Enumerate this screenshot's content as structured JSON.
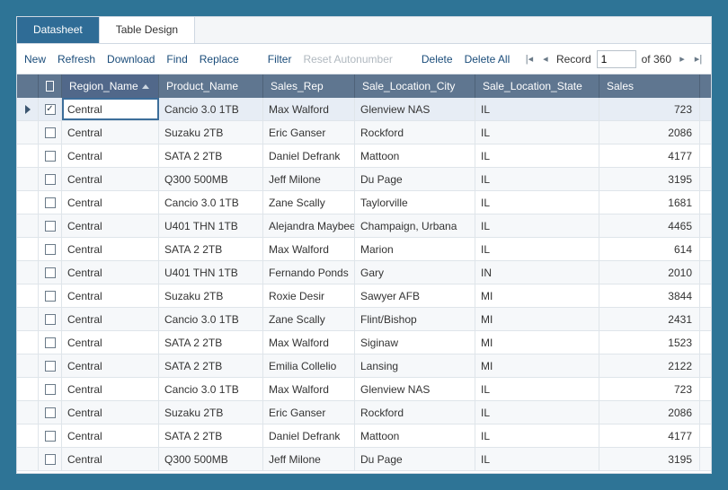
{
  "tabs": {
    "datasheet": "Datasheet",
    "design": "Table Design"
  },
  "toolbar": {
    "new": "New",
    "refresh": "Refresh",
    "download": "Download",
    "find": "Find",
    "replace": "Replace",
    "filter": "Filter",
    "reset_autonumber": "Reset Autonumber",
    "delete": "Delete",
    "delete_all": "Delete All",
    "record_label": "Record",
    "record_value": "1",
    "record_total_prefix": "of ",
    "record_total": "360"
  },
  "columns": {
    "region": "Region_Name",
    "product": "Product_Name",
    "rep": "Sales_Rep",
    "city": "Sale_Location_City",
    "state": "Sale_Location_State",
    "sales": "Sales"
  },
  "rows": [
    {
      "checked": true,
      "region": "Central",
      "product": "Cancio 3.0 1TB",
      "rep": "Max Walford",
      "city": "Glenview NAS",
      "state": "IL",
      "sales": "723",
      "current": true
    },
    {
      "checked": false,
      "region": "Central",
      "product": "Suzaku 2TB",
      "rep": "Eric Ganser",
      "city": "Rockford",
      "state": "IL",
      "sales": "2086"
    },
    {
      "checked": false,
      "region": "Central",
      "product": "SATA 2 2TB",
      "rep": "Daniel Defrank",
      "city": "Mattoon",
      "state": "IL",
      "sales": "4177"
    },
    {
      "checked": false,
      "region": "Central",
      "product": "Q300 500MB",
      "rep": "Jeff Milone",
      "city": "Du Page",
      "state": "IL",
      "sales": "3195"
    },
    {
      "checked": false,
      "region": "Central",
      "product": "Cancio 3.0 1TB",
      "rep": "Zane Scally",
      "city": "Taylorville",
      "state": "IL",
      "sales": "1681"
    },
    {
      "checked": false,
      "region": "Central",
      "product": "U401 THN 1TB",
      "rep": "Alejandra Maybee",
      "city": "Champaign, Urbana",
      "state": "IL",
      "sales": "4465"
    },
    {
      "checked": false,
      "region": "Central",
      "product": "SATA 2 2TB",
      "rep": "Max Walford",
      "city": "Marion",
      "state": "IL",
      "sales": "614"
    },
    {
      "checked": false,
      "region": "Central",
      "product": "U401 THN 1TB",
      "rep": "Fernando Ponds",
      "city": "Gary",
      "state": "IN",
      "sales": "2010"
    },
    {
      "checked": false,
      "region": "Central",
      "product": "Suzaku 2TB",
      "rep": "Roxie Desir",
      "city": "Sawyer AFB",
      "state": "MI",
      "sales": "3844"
    },
    {
      "checked": false,
      "region": "Central",
      "product": "Cancio 3.0 1TB",
      "rep": "Zane Scally",
      "city": "Flint/Bishop",
      "state": "MI",
      "sales": "2431"
    },
    {
      "checked": false,
      "region": "Central",
      "product": "SATA 2 2TB",
      "rep": "Max Walford",
      "city": "Siginaw",
      "state": "MI",
      "sales": "1523"
    },
    {
      "checked": false,
      "region": "Central",
      "product": "SATA 2 2TB",
      "rep": "Emilia Collelio",
      "city": "Lansing",
      "state": "MI",
      "sales": "2122"
    },
    {
      "checked": false,
      "region": "Central",
      "product": "Cancio 3.0 1TB",
      "rep": "Max Walford",
      "city": "Glenview NAS",
      "state": "IL",
      "sales": "723"
    },
    {
      "checked": false,
      "region": "Central",
      "product": "Suzaku 2TB",
      "rep": "Eric Ganser",
      "city": "Rockford",
      "state": "IL",
      "sales": "2086"
    },
    {
      "checked": false,
      "region": "Central",
      "product": "SATA 2 2TB",
      "rep": "Daniel Defrank",
      "city": "Mattoon",
      "state": "IL",
      "sales": "4177"
    },
    {
      "checked": false,
      "region": "Central",
      "product": "Q300 500MB",
      "rep": "Jeff Milone",
      "city": "Du Page",
      "state": "IL",
      "sales": "3195"
    }
  ]
}
